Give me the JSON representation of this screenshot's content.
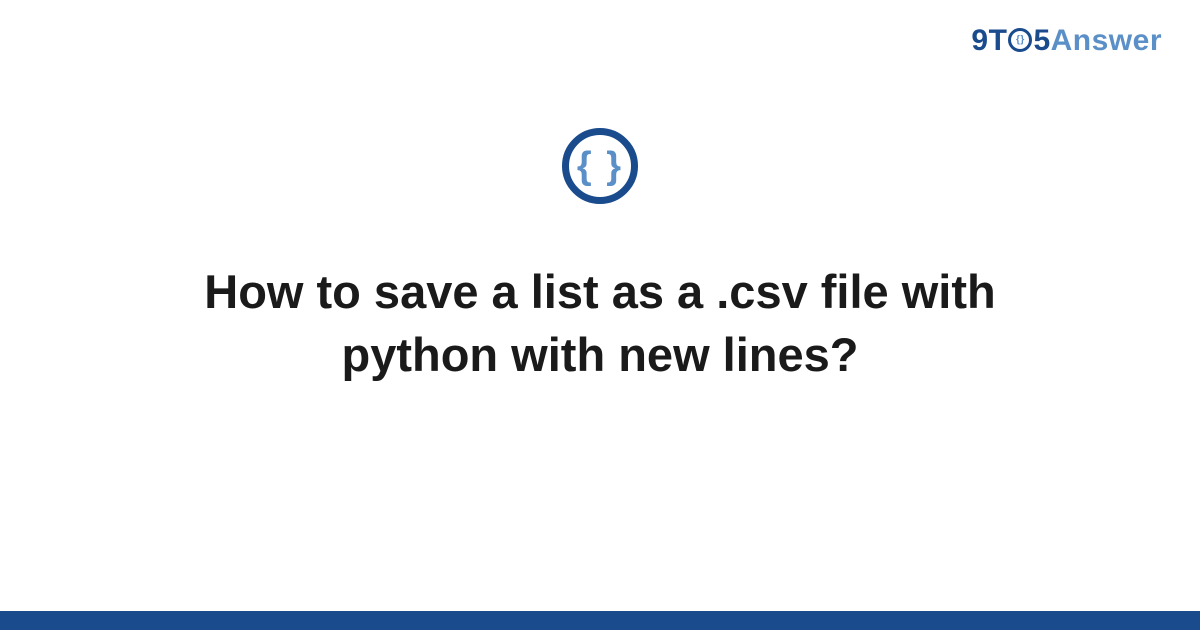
{
  "logo": {
    "part1": "9T",
    "part2": "5",
    "part3": "Answer"
  },
  "icon": {
    "glyph": "{ }"
  },
  "title": "How to save a list as a .csv file with python with new lines?",
  "colors": {
    "primary": "#1a4b8c",
    "secondary": "#5a8fc7"
  }
}
